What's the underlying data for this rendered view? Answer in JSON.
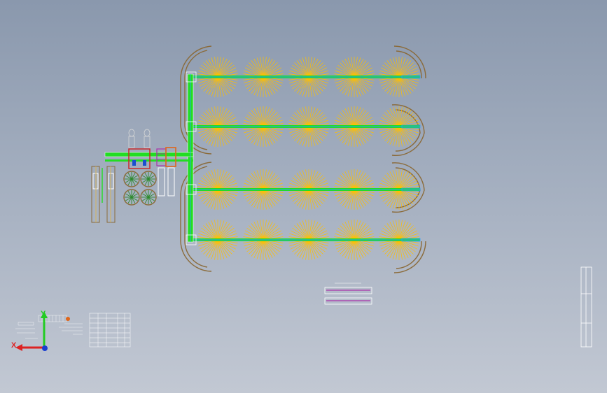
{
  "viewport": {
    "background_top": "#8a98ad",
    "background_bottom": "#c2c8d3"
  },
  "colors": {
    "sprinkler": "#ffc000",
    "pipe_main": "#22dd22",
    "pipe_edge": "#2aa0ff",
    "curb": "#8b6b3a",
    "drawing_white": "#ffffff",
    "machine_red": "#cc2222",
    "machine_orange": "#e0661a",
    "machine_purple": "#aa33aa",
    "reel_green": "#2e8b2e"
  },
  "layout": {
    "rows": 4,
    "sprinklers_per_row": 5
  },
  "triad": {
    "x_label": "X",
    "y_label": "Y",
    "icon": "coordinate-triad-icon"
  },
  "annotations": {
    "title_block": "title-block-table",
    "detail_view": "pipe-section-detail",
    "frame": "drawing-border-frame"
  }
}
